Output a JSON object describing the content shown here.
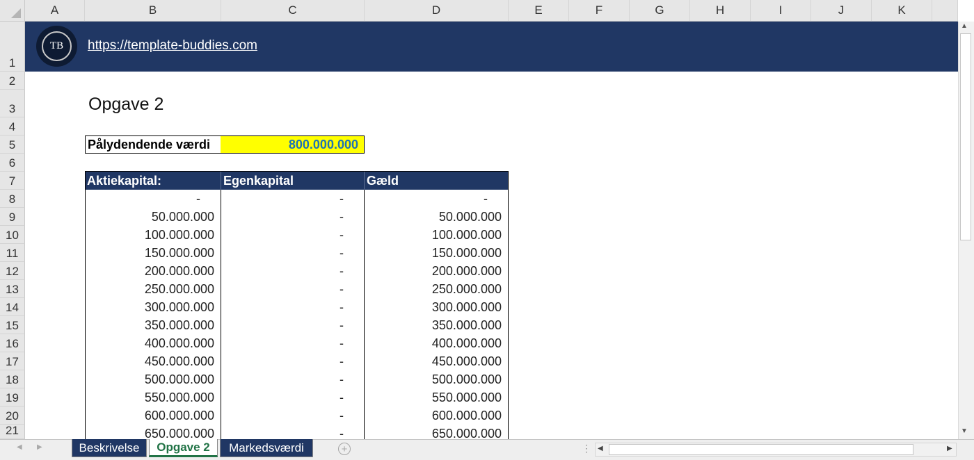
{
  "colors": {
    "header_navy": "#203764",
    "highlight_yellow": "#ffff00",
    "value_blue": "#1e73b4",
    "active_tab_green": "#217346"
  },
  "columns": [
    "A",
    "B",
    "C",
    "D",
    "E",
    "F",
    "G",
    "H",
    "I",
    "J",
    "K"
  ],
  "rows": [
    "1",
    "2",
    "3",
    "4",
    "5",
    "6",
    "7",
    "8",
    "9",
    "10",
    "11",
    "12",
    "13",
    "14",
    "15",
    "16",
    "17",
    "18",
    "19",
    "20",
    "21"
  ],
  "banner": {
    "logo_text": "TB",
    "link": "https://template-buddies.com"
  },
  "sheet": {
    "title": "Opgave 2",
    "face_value": {
      "label": "Pålydendende værdi",
      "value": "800.000.000"
    },
    "table": {
      "headers": [
        "Aktiekapital:",
        "Egenkapital",
        "Gæld"
      ],
      "rows": [
        [
          "-",
          "-",
          "-"
        ],
        [
          "50.000.000",
          "-",
          "50.000.000"
        ],
        [
          "100.000.000",
          "-",
          "100.000.000"
        ],
        [
          "150.000.000",
          "-",
          "150.000.000"
        ],
        [
          "200.000.000",
          "-",
          "200.000.000"
        ],
        [
          "250.000.000",
          "-",
          "250.000.000"
        ],
        [
          "300.000.000",
          "-",
          "300.000.000"
        ],
        [
          "350.000.000",
          "-",
          "350.000.000"
        ],
        [
          "400.000.000",
          "-",
          "400.000.000"
        ],
        [
          "450.000.000",
          "-",
          "450.000.000"
        ],
        [
          "500.000.000",
          "-",
          "500.000.000"
        ],
        [
          "550.000.000",
          "-",
          "550.000.000"
        ],
        [
          "600.000.000",
          "-",
          "600.000.000"
        ],
        [
          "650.000.000",
          "-",
          "650.000.000"
        ]
      ]
    }
  },
  "tabs": [
    {
      "label": "Beskrivelse",
      "active": false
    },
    {
      "label": "Opgave 2",
      "active": true
    },
    {
      "label": "Markedsværdi",
      "active": false
    }
  ],
  "icons": {
    "add_sheet": "plus-circle-icon",
    "scroll_left": "triangle-left-icon",
    "scroll_right": "triangle-right-icon",
    "scroll_up": "triangle-up-icon",
    "scroll_down": "triangle-down-icon"
  }
}
